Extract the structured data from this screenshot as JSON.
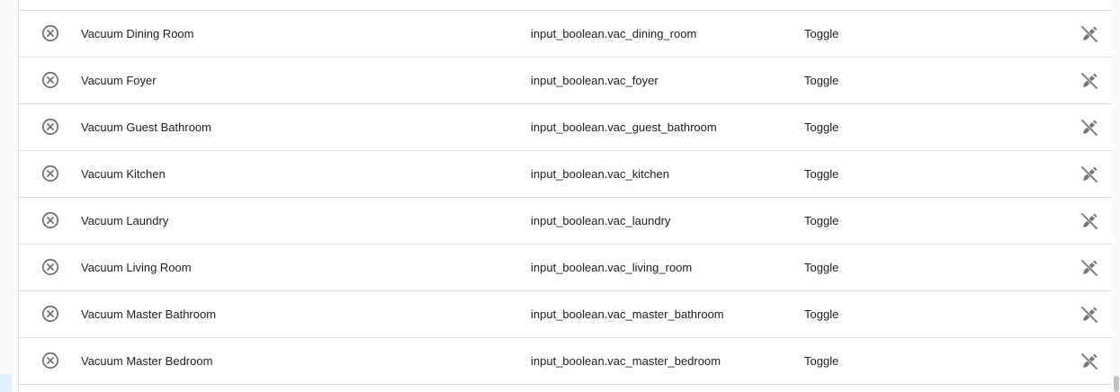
{
  "rows": [
    {
      "name": "Vacuum Dining Room",
      "entity_id": "input_boolean.vac_dining_room",
      "domain": "Toggle",
      "status_icon": "close-circle-icon",
      "edit_icon": "pencil-off-icon"
    },
    {
      "name": "Vacuum Foyer",
      "entity_id": "input_boolean.vac_foyer",
      "domain": "Toggle",
      "status_icon": "close-circle-icon",
      "edit_icon": "pencil-off-icon"
    },
    {
      "name": "Vacuum Guest Bathroom",
      "entity_id": "input_boolean.vac_guest_bathroom",
      "domain": "Toggle",
      "status_icon": "close-circle-icon",
      "edit_icon": "pencil-off-icon"
    },
    {
      "name": "Vacuum Kitchen",
      "entity_id": "input_boolean.vac_kitchen",
      "domain": "Toggle",
      "status_icon": "close-circle-icon",
      "edit_icon": "pencil-off-icon"
    },
    {
      "name": "Vacuum Laundry",
      "entity_id": "input_boolean.vac_laundry",
      "domain": "Toggle",
      "status_icon": "close-circle-icon",
      "edit_icon": "pencil-off-icon"
    },
    {
      "name": "Vacuum Living Room",
      "entity_id": "input_boolean.vac_living_room",
      "domain": "Toggle",
      "status_icon": "close-circle-icon",
      "edit_icon": "pencil-off-icon"
    },
    {
      "name": "Vacuum Master Bathroom",
      "entity_id": "input_boolean.vac_master_bathroom",
      "domain": "Toggle",
      "status_icon": "close-circle-icon",
      "edit_icon": "pencil-off-icon"
    },
    {
      "name": "Vacuum Master Bedroom",
      "entity_id": "input_boolean.vac_master_bedroom",
      "domain": "Toggle",
      "status_icon": "close-circle-icon",
      "edit_icon": "pencil-off-icon"
    }
  ],
  "colors": {
    "icon": "#757575",
    "divider": "#e0e0e0",
    "text": "#212121"
  }
}
